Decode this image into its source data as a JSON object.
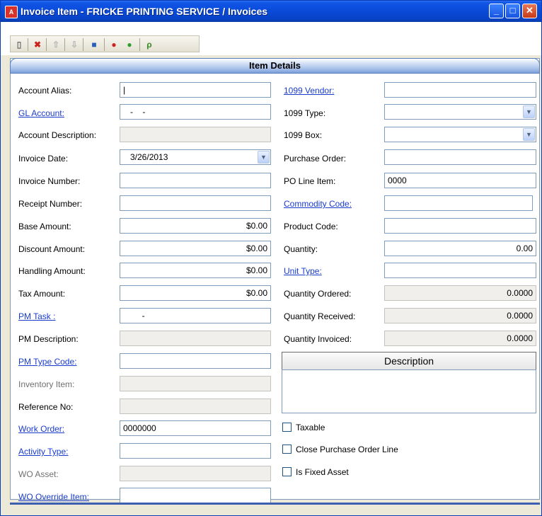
{
  "window": {
    "app_icon_text": "A",
    "title": "Invoice Item - FRICKE PRINTING SERVICE / Invoices",
    "minimize_label": "_",
    "maximize_label": "□",
    "close_label": "✕"
  },
  "toolbar_icons": [
    "new-document-icon",
    "delete-icon",
    "move-up-icon",
    "move-down-icon",
    "save-icon",
    "stop-icon",
    "help-icon",
    "lookup-icon"
  ],
  "section": {
    "title": "Item Details"
  },
  "left": {
    "account_alias": {
      "label": "Account Alias:",
      "value": "|"
    },
    "gl_account": {
      "label": "GL Account:",
      "value": "   -    -"
    },
    "account_description": {
      "label": "Account Description:",
      "value": ""
    },
    "invoice_date": {
      "label": "Invoice Date:",
      "value": "3/26/2013"
    },
    "invoice_number": {
      "label": "Invoice Number:",
      "value": ""
    },
    "receipt_number": {
      "label": "Receipt Number:",
      "value": ""
    },
    "base_amount": {
      "label": "Base Amount:",
      "value": "$0.00"
    },
    "discount_amount": {
      "label": "Discount Amount:",
      "value": "$0.00"
    },
    "handling_amount": {
      "label": "Handling Amount:",
      "value": "$0.00"
    },
    "tax_amount": {
      "label": "Tax Amount:",
      "value": "$0.00"
    },
    "pm_task": {
      "label": "PM Task :",
      "value": "        -"
    },
    "pm_description": {
      "label": "PM Description:",
      "value": ""
    },
    "pm_type_code": {
      "label": "PM Type Code:",
      "value": ""
    },
    "inventory_item": {
      "label": "Inventory Item:",
      "value": ""
    },
    "reference_no": {
      "label": "Reference No:",
      "value": ""
    },
    "work_order": {
      "label": "Work Order:",
      "value": "0000000"
    },
    "activity_type": {
      "label": "Activity Type:",
      "value": ""
    },
    "wo_asset": {
      "label": "WO Asset:",
      "value": ""
    },
    "wo_override_item": {
      "label": "WO Override Item:",
      "value": ""
    }
  },
  "right": {
    "vendor_1099": {
      "label": "1099 Vendor:",
      "value": ""
    },
    "type_1099": {
      "label": "1099 Type:",
      "value": ""
    },
    "box_1099": {
      "label": "1099 Box:",
      "value": ""
    },
    "purchase_order": {
      "label": "Purchase Order:",
      "value": ""
    },
    "po_line_item": {
      "label": "PO Line Item:",
      "value": "0000"
    },
    "commodity_code": {
      "label": "Commodity Code:",
      "value": ""
    },
    "product_code": {
      "label": "Product Code:",
      "value": ""
    },
    "quantity": {
      "label": "Quantity:",
      "value": "0.00"
    },
    "unit_type": {
      "label": "Unit Type:",
      "value": ""
    },
    "quantity_ordered": {
      "label": "Quantity Ordered:",
      "value": "0.0000"
    },
    "quantity_received": {
      "label": "Quantity Received:",
      "value": "0.0000"
    },
    "quantity_invoiced": {
      "label": "Quantity Invoiced:",
      "value": "0.0000"
    },
    "description": {
      "header": "Description",
      "value": ""
    },
    "taxable": {
      "label": "Taxable",
      "checked": false
    },
    "close_po_line": {
      "label": "Close Purchase Order Line",
      "checked": false
    },
    "is_fixed_asset": {
      "label": "Is Fixed Asset",
      "checked": false
    }
  },
  "colors": {
    "link": "#1a3ccc",
    "titlebar": "#0a4ad8",
    "readonly_bg": "#f0efeb"
  }
}
